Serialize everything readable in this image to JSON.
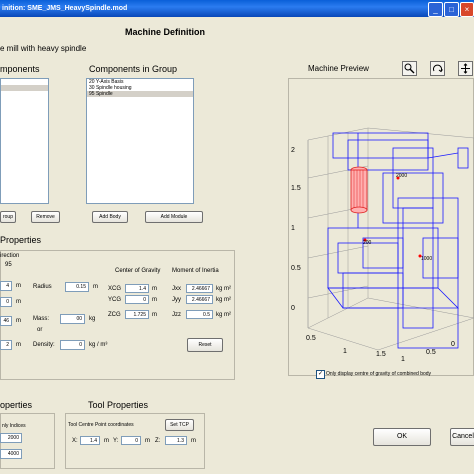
{
  "window": {
    "title": "inition: SME_JMS_HeavySpindle.mod",
    "min": "_",
    "max": "□",
    "close": "×"
  },
  "page_title": "Machine Definition",
  "machine_desc": "e mill with heavy spindle",
  "components": {
    "label": "mponents",
    "items": [
      "",
      ""
    ],
    "group_btn": "roup",
    "remove_btn": "Remove"
  },
  "group": {
    "label": "Components in Group",
    "items": [
      "20 Y-Axis Basis",
      "30 Spindle housing",
      "95 Spindle"
    ],
    "selected_index": 2,
    "add_body_btn": "Add Body",
    "add_module_btn": "Add Module"
  },
  "properties": {
    "label": "Properties",
    "direction_label": "irection",
    "direction_value": "95",
    "radius_label": "Radius",
    "radius_value": "0.15",
    "radius_unit": "m",
    "mass_label": "Mass:",
    "mass_value": "00",
    "mass_unit": "kg",
    "or_label": "or",
    "density_label": "Density:",
    "density_value": "0",
    "density_unit": "kg / m³",
    "left_values": [
      "4",
      "0",
      "46",
      "2"
    ],
    "left_units": [
      "m",
      "m",
      "m",
      "m"
    ],
    "cog_label": "Center of Gravity",
    "moi_label": "Moment of Inertia",
    "rows": [
      {
        "axis": "XCG",
        "cog": "1.4",
        "moi_label": "Jxx",
        "moi": "2.46667",
        "moi_unit": "kg m²"
      },
      {
        "axis": "YCG",
        "cog": "0",
        "moi_label": "Jyy",
        "moi": "2.46667",
        "moi_unit": "kg m²"
      },
      {
        "axis": "ZCG",
        "cog": "1.725",
        "moi_label": "Jzz",
        "moi": "0.5",
        "moi_unit": "kg m²"
      }
    ],
    "cog_unit": "m",
    "reset_btn": "Reset"
  },
  "preview": {
    "label": "Machine Preview",
    "icons": [
      "zoom-icon",
      "rotate-icon",
      "pan-icon"
    ],
    "z_ticks": [
      "2",
      "1.5",
      "1",
      "0.5",
      "0"
    ],
    "x_ticks": [
      "1.5",
      "1",
      "0.5",
      "0"
    ],
    "y_ticks": [
      "0.5",
      "1"
    ],
    "points": [
      "2000",
      "200",
      "1000"
    ],
    "checkbox_label": "Only display centre of gravity of combined body",
    "checkbox_checked": true
  },
  "bottom": {
    "props_label": "operties",
    "indices_label": "nly Indices",
    "index_values": [
      "2000",
      "4000"
    ],
    "tool_label": "Tool Properties",
    "tcp_label": "Tool Centre Point coordinates",
    "set_tcp_btn": "Set TCP",
    "x_label": "X:",
    "x_value": "1.4",
    "x_unit": "m",
    "y_label": "Y:",
    "y_value": "0",
    "y_unit": "m",
    "z_label": "Z:",
    "z_value": "1.3",
    "z_unit": "m"
  },
  "ok_btn": "OK",
  "cancel_btn": "Cancel",
  "colors": {
    "title_bar": "#0a5fd8",
    "plot_lines": "#1a1aff",
    "spindle": "#e02020",
    "cog": "#ff0000"
  }
}
